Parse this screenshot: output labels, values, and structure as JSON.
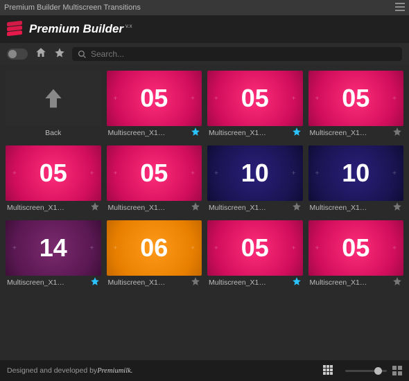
{
  "window": {
    "title": "Premium Builder Multiscreen Transitions"
  },
  "brand": {
    "name": "Premium Builder",
    "version": "v.x"
  },
  "search": {
    "placeholder": "Search..."
  },
  "back": {
    "label": "Back"
  },
  "items": [
    {
      "num": "05",
      "label": "Multiscreen_X1…",
      "color": "pink",
      "fav": true
    },
    {
      "num": "05",
      "label": "Multiscreen_X1…",
      "color": "pink",
      "fav": true
    },
    {
      "num": "05",
      "label": "Multiscreen_X1…",
      "color": "pink",
      "fav": false
    },
    {
      "num": "05",
      "label": "Multiscreen_X1…",
      "color": "pink",
      "fav": false
    },
    {
      "num": "05",
      "label": "Multiscreen_X1…",
      "color": "pink",
      "fav": false
    },
    {
      "num": "10",
      "label": "Multiscreen_X1…",
      "color": "navy",
      "fav": false
    },
    {
      "num": "10",
      "label": "Multiscreen_X1…",
      "color": "navy",
      "fav": false
    },
    {
      "num": "14",
      "label": "Multiscreen_X1…",
      "color": "purple",
      "fav": true
    },
    {
      "num": "06",
      "label": "Multiscreen_X1…",
      "color": "orange",
      "fav": false
    },
    {
      "num": "05",
      "label": "Multiscreen_X1…",
      "color": "pink",
      "fav": true
    },
    {
      "num": "05",
      "label": "Multiscreen_X1…",
      "color": "pink",
      "fav": false
    }
  ],
  "footer": {
    "prefix": "Designed and developed by ",
    "credit": "Premiumilk."
  },
  "colors": {
    "accent": "#e6194b"
  }
}
